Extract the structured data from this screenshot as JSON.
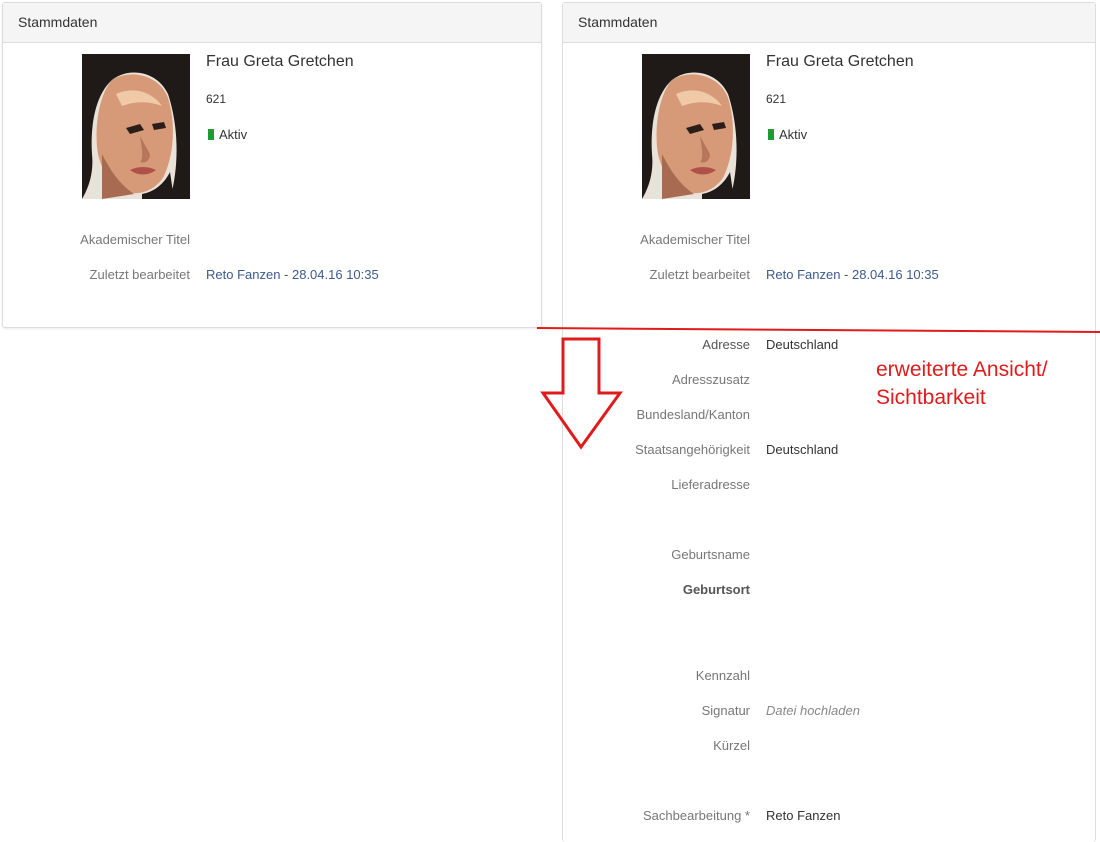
{
  "left_panel": {
    "heading": "Stammdaten",
    "name": "Frau Greta Gretchen",
    "number": "621",
    "status": "Aktiv",
    "fields": [
      {
        "label": "Akademischer Titel",
        "value": ""
      },
      {
        "label": "Zuletzt bearbeitet",
        "value": "Reto Fanzen - 28.04.16 10:35"
      }
    ]
  },
  "right_panel": {
    "heading": "Stammdaten",
    "name": "Frau Greta Gretchen",
    "number": "621",
    "status": "Aktiv",
    "fields": [
      {
        "label": "Akademischer Titel",
        "value": ""
      },
      {
        "label": "Zuletzt bearbeitet",
        "value": "Reto Fanzen - 28.04.16 10:35"
      }
    ],
    "extended_fields": [
      {
        "label": "Adresse",
        "value": "Deutschland"
      },
      {
        "label": "Adresszusatz",
        "value": ""
      },
      {
        "label": "Bundesland/Kanton",
        "value": ""
      },
      {
        "label": "Staatsangehörigkeit",
        "value": "Deutschland"
      },
      {
        "label": "Lieferadresse",
        "value": ""
      },
      {
        "label": "Geburtsname",
        "value": ""
      },
      {
        "label": "Geburtsort",
        "value": ""
      },
      {
        "label": "Kennzahl",
        "value": ""
      },
      {
        "label": "Signatur",
        "value": "Datei hochladen"
      },
      {
        "label": "Kürzel",
        "value": ""
      },
      {
        "label": "Sachbearbeitung *",
        "value": "Reto Fanzen"
      }
    ]
  },
  "annotation": {
    "line1": "erweiterte Ansicht/",
    "line2": "Sichtbarkeit",
    "color": "#e01b1b"
  },
  "colors": {
    "status_active": "#1e9b35",
    "link": "#3c5a8f",
    "heading_bg": "#f5f5f5"
  }
}
